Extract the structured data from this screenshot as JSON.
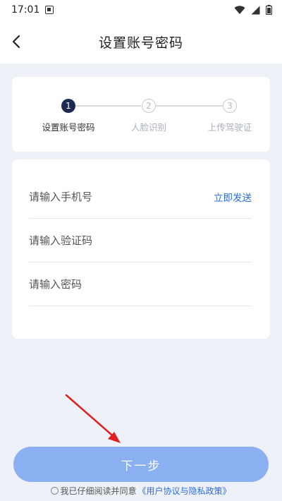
{
  "status_bar": {
    "time": "17:01",
    "icons": [
      "app-notification-icon",
      "wifi-icon",
      "signal-icon",
      "battery-icon"
    ]
  },
  "header": {
    "title": "设置账号密码",
    "back_icon": "chevron-left-icon"
  },
  "steps": [
    {
      "number": "1",
      "label": "设置账号密码",
      "state": "active"
    },
    {
      "number": "2",
      "label": "人脸识别",
      "state": "inactive"
    },
    {
      "number": "3",
      "label": "上传驾驶证",
      "state": "inactive"
    }
  ],
  "form": {
    "phone_placeholder": "请输入手机号",
    "send_code_label": "立即发送",
    "code_placeholder": "请输入验证码",
    "password_placeholder": "请输入密码"
  },
  "next_button": {
    "label": "下一步"
  },
  "agreement": {
    "prefix": "我已仔细阅读并同意",
    "link": "《用户协议与隐私政策》"
  },
  "colors": {
    "accent": "#2e6bdc",
    "button_bg": "#8ab0f2",
    "active_step": "#1d2a52",
    "page_bg": "#eef2f8",
    "annotation_arrow": "#e02020"
  }
}
